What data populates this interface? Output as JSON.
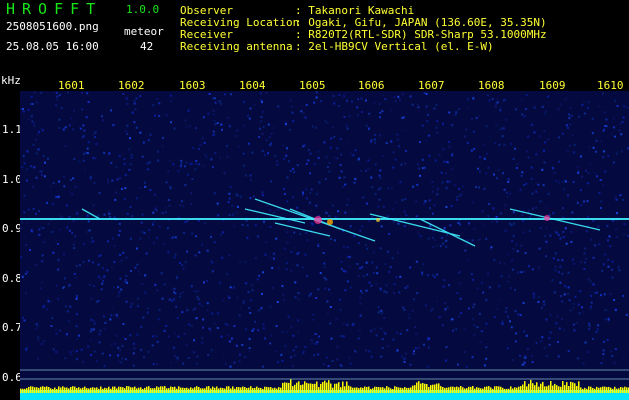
{
  "header": {
    "app_title": "HROFFT",
    "version": "1.0.0",
    "filename": "2508051600.png",
    "datetime": "25.08.05 16:00",
    "meteor_label": "meteor",
    "meteor_count": "42"
  },
  "info": [
    {
      "key": "Observer",
      "value": ": Takanori Kawachi"
    },
    {
      "key": "Receiving Location",
      "value": ": Ogaki, Gifu, JAPAN (136.60E, 35.35N)"
    },
    {
      "key": "Receiver",
      "value": ": R820T2(RTL-SDR) SDR-Sharp 53.1000MHz"
    },
    {
      "key": "Receiving antenna",
      "value": ": 2el-HB9CV Vertical (el. E-W)"
    }
  ],
  "axis": {
    "y_unit": "kHz",
    "x_ticks": [
      "1601",
      "1602",
      "1603",
      "1604",
      "1605",
      "1606",
      "1607",
      "1608",
      "1609",
      "1610"
    ],
    "y_ticks": [
      "1.1",
      "1.0",
      "0.9",
      "0.8",
      "0.7",
      "0.6"
    ]
  },
  "colors": {
    "background": "#000000",
    "header_green": "#19e619",
    "label_yellow": "#ffff33",
    "spectrum_blue": "#0a1a8c",
    "trace_cyan": "#40f0ff",
    "bottom_bar": "#00e5ff",
    "bottom_peaks": "#ffff00"
  }
}
